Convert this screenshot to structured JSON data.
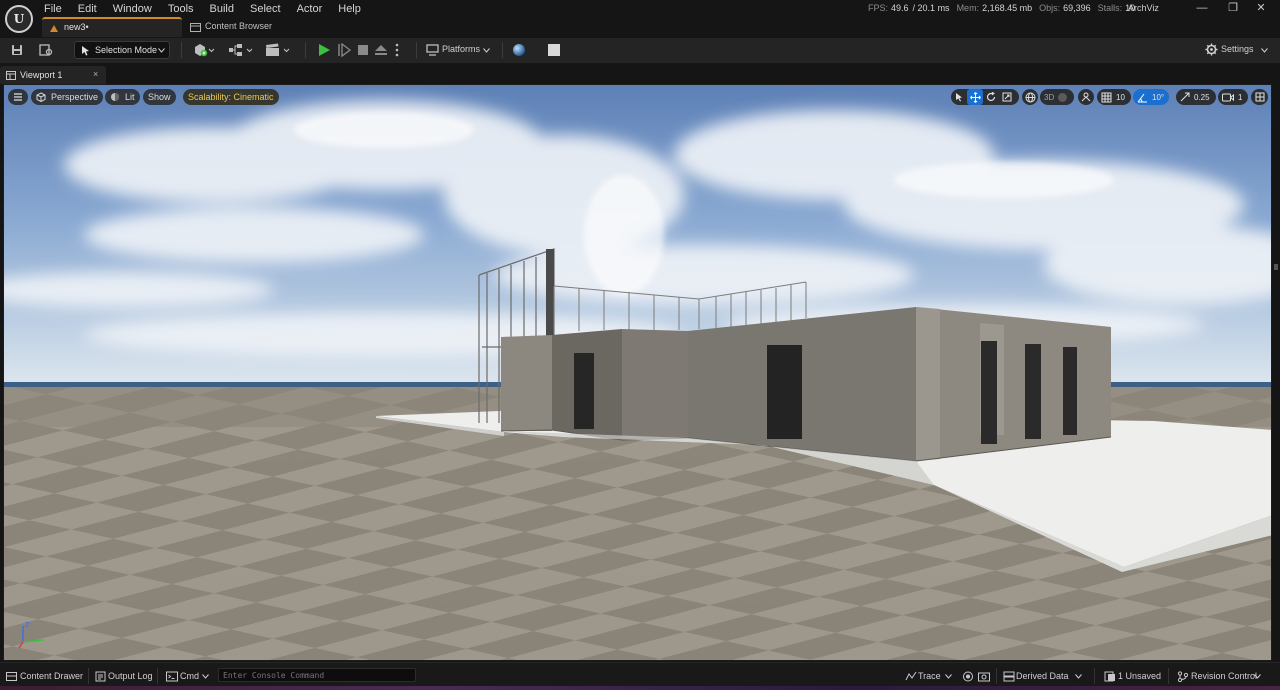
{
  "menu": [
    "File",
    "Edit",
    "Window",
    "Tools",
    "Build",
    "Select",
    "Actor",
    "Help"
  ],
  "stats": {
    "fps_label": "FPS:",
    "fps": "49.6",
    "ms": "/ 20.1 ms",
    "mem_label": "Mem:",
    "mem": "2,168.45 mb",
    "objs_label": "Objs:",
    "objs": "69,396",
    "stalls_label": "Stalls:",
    "stalls": "10"
  },
  "project_name": "ArchViz",
  "window_controls": {
    "minimize": "—",
    "restore": "❐",
    "close": "✕"
  },
  "tabs": {
    "level": "new3•",
    "content_browser": "Content Browser"
  },
  "toolbar": {
    "selection_mode": "Selection Mode",
    "platforms": "Platforms",
    "settings": "Settings"
  },
  "viewport_tab": {
    "label": "Viewport 1",
    "close": "×"
  },
  "viewport": {
    "perspective": "Perspective",
    "lit": "Lit",
    "show": "Show",
    "scalability": "Scalability: Cinematic",
    "mode_3d": "3D",
    "grid_snap": "10",
    "rotation_snap": "10°",
    "scale_snap": "0.25",
    "camera_speed": "1",
    "axis_z": "Z"
  },
  "statusbar": {
    "content_drawer": "Content Drawer",
    "output_log": "Output Log",
    "cmd": "Cmd",
    "console_placeholder": "Enter Console Command",
    "trace": "Trace",
    "derived_data": "Derived Data",
    "unsaved": "1 Unsaved",
    "revision_control": "Revision Control"
  },
  "colors": {
    "accent_blue": "#1b6fd1",
    "play_green": "#3fbf3f",
    "scalability_yellow": "#e8c85a",
    "level_tab_orange": "#d28a2a"
  },
  "icons": [
    "unreal-logo-icon",
    "save-icon",
    "browse-icon",
    "add-actor-icon",
    "blueprint-icon",
    "cinematics-icon",
    "play-icon",
    "step-icon",
    "stop-icon",
    "eject-icon",
    "more-icon",
    "platforms-icon",
    "sphere-icon",
    "square-icon",
    "gear-icon",
    "hamburger-icon",
    "select-icon",
    "move-icon",
    "rotate-icon",
    "scale-icon",
    "globe-icon",
    "snap-icon",
    "grid-icon",
    "angle-icon",
    "scale-snap-icon",
    "camera-icon",
    "maximize-icon"
  ]
}
